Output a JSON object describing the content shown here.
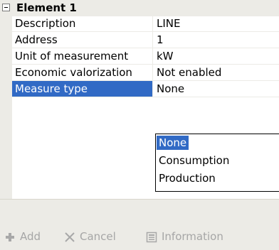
{
  "category": {
    "label": "Element 1"
  },
  "properties": [
    {
      "name": "Description",
      "value": "LINE"
    },
    {
      "name": "Address",
      "value": "1"
    },
    {
      "name": "Unit of measurement",
      "value": "kW"
    },
    {
      "name": "Economic valorization",
      "value": "Not enabled"
    },
    {
      "name": "Measure type",
      "value": "None"
    }
  ],
  "dropdown": {
    "options": [
      "None",
      "Consumption",
      "Production"
    ],
    "highlighted": "None"
  },
  "toolbar": {
    "add_label": "Add",
    "cancel_label": "Cancel",
    "info_label": "Information"
  },
  "colors": {
    "selection": "#316ac5",
    "gutter": "#ecebe6",
    "disabled_text": "#a6a6a6"
  },
  "icons": {
    "add": "plus-icon",
    "cancel": "x-icon",
    "info": "information-icon",
    "dropdown": "chevron-down-icon"
  }
}
